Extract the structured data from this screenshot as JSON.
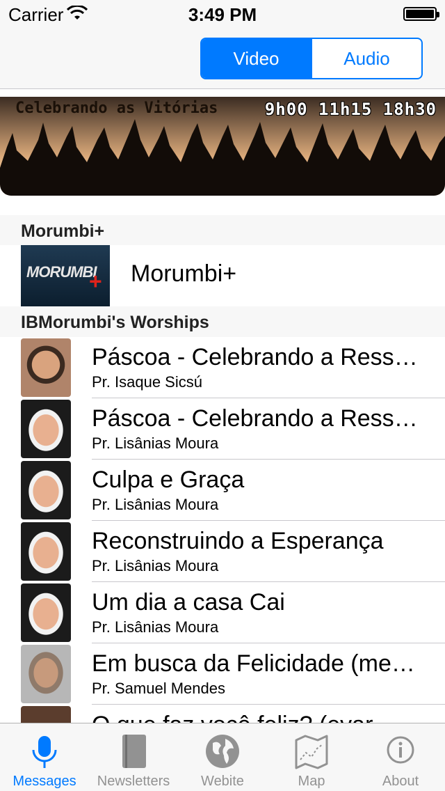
{
  "status_bar": {
    "carrier": "Carrier",
    "time": "3:49 PM"
  },
  "segment": {
    "video": "Video",
    "audio": "Audio",
    "selected": "Video"
  },
  "banner": {
    "title": "Celebrando as Vitórias",
    "times": "9h00 11h15 18h30"
  },
  "sections": {
    "featured_header": "Morumbi+",
    "worships_header": "IBMorumbi's Worships"
  },
  "featured": {
    "thumb_text": "MORUMBI",
    "thumb_plus": "+",
    "label": "Morumbi+"
  },
  "worships": [
    {
      "title": "Páscoa - Celebrando a Ressurreição",
      "speaker": "Pr. Isaque Sicsú"
    },
    {
      "title": "Páscoa - Celebrando a Ressurreição",
      "speaker": "Pr. Lisânias Moura"
    },
    {
      "title": "Culpa e Graça",
      "speaker": "Pr. Lisânias Moura"
    },
    {
      "title": "Reconstruindo a Esperança",
      "speaker": "Pr. Lisânias Moura"
    },
    {
      "title": "Um dia a casa Cai",
      "speaker": "Pr. Lisânias Moura"
    },
    {
      "title": "Em busca da Felicidade (mensagem)",
      "speaker": "Pr. Samuel Mendes"
    },
    {
      "title": "O que faz você feliz? (evar",
      "speaker": ""
    }
  ],
  "tabbar": {
    "items": [
      {
        "label": "Messages",
        "icon": "microphone-icon",
        "active": true
      },
      {
        "label": "Newsletters",
        "icon": "book-icon",
        "active": false
      },
      {
        "label": "Webite",
        "icon": "globe-icon",
        "active": false
      },
      {
        "label": "Map",
        "icon": "map-icon",
        "active": false
      },
      {
        "label": "About",
        "icon": "info-icon",
        "active": false
      }
    ]
  },
  "colors": {
    "accent": "#007aff",
    "inactive": "#929292",
    "bar_bg": "#f7f7f7"
  }
}
